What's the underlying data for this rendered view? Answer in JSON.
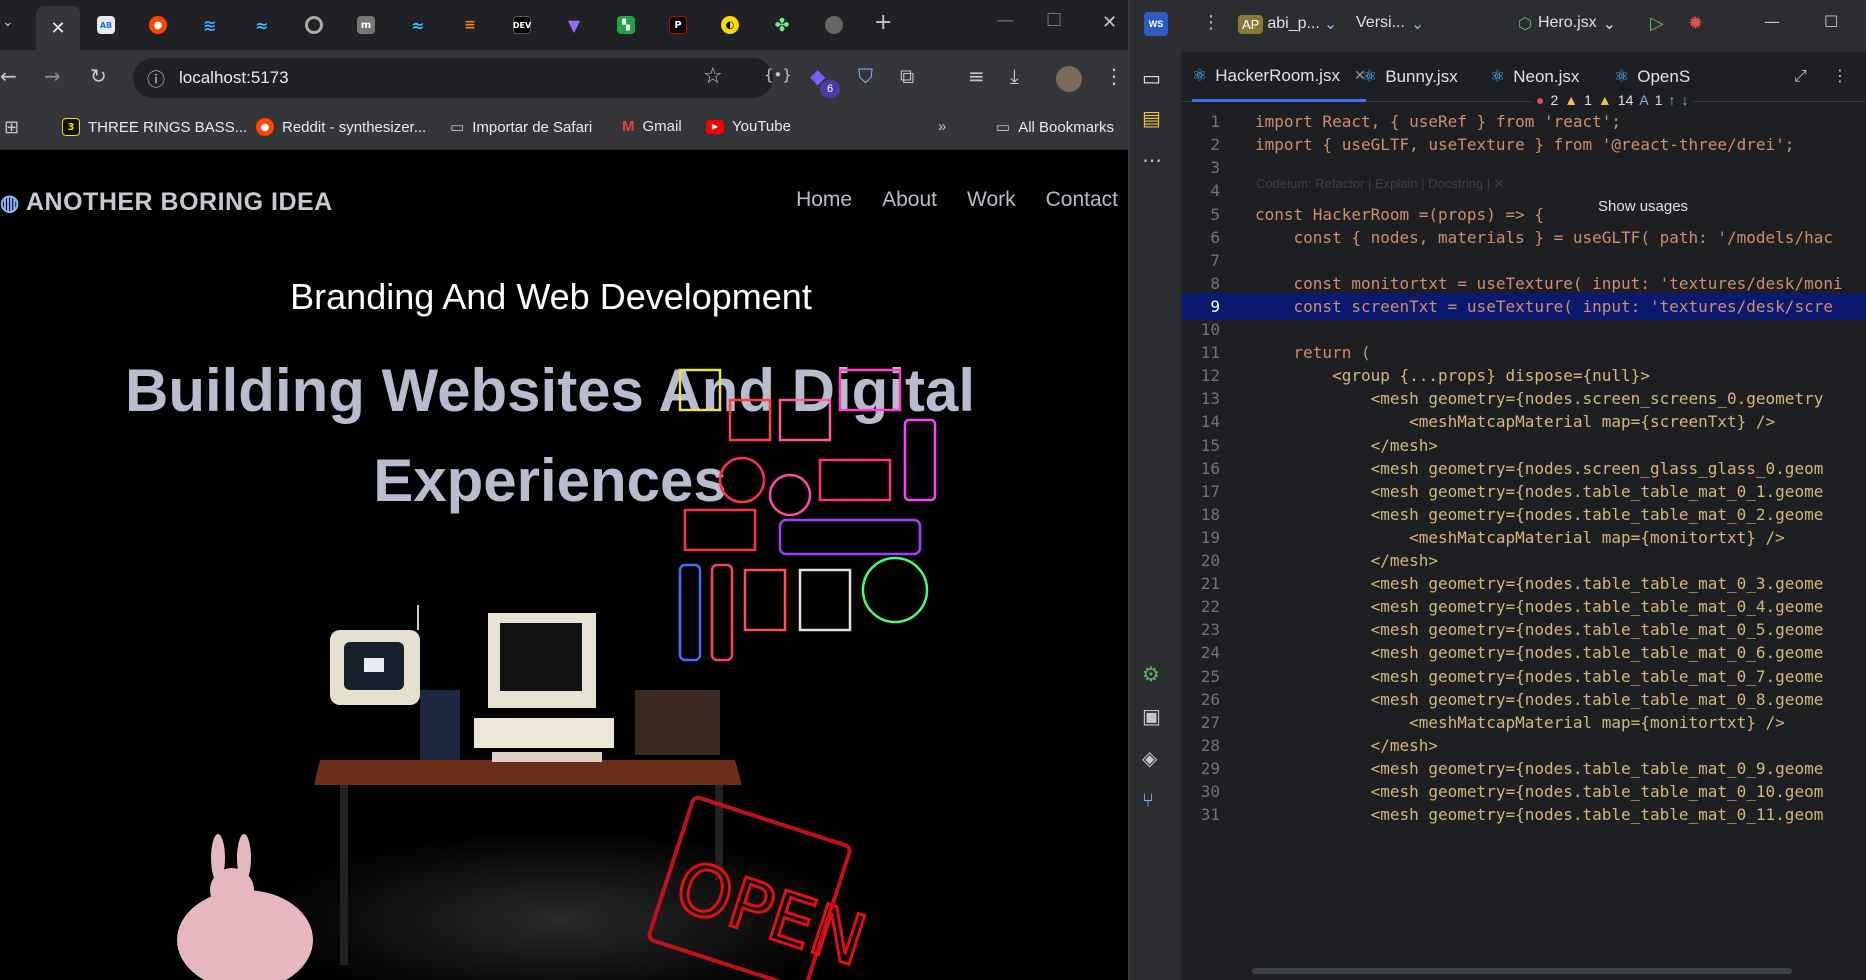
{
  "browser": {
    "url": "localhost:5173",
    "extension_badge": "6",
    "bookmarks": [
      {
        "label": "THREE RINGS BASS...",
        "icon": "three-rings-icon"
      },
      {
        "label": "Reddit - synthesizer...",
        "icon": "reddit-icon"
      },
      {
        "label": "Importar de Safari",
        "icon": "folder-icon"
      },
      {
        "label": "Gmail",
        "icon": "gmail-icon"
      },
      {
        "label": "YouTube",
        "icon": "youtube-icon"
      }
    ],
    "all_bookmarks": "All Bookmarks"
  },
  "site": {
    "logo": "ANOTHER BORING IDEA",
    "nav": [
      "Home",
      "About",
      "Work",
      "Contact"
    ],
    "subtitle": "Branding And Web Development",
    "title_line1": "Building Websites And Digital",
    "title_line2": "Experiences",
    "open_sign": "OPEN"
  },
  "ide": {
    "project": "abi_p...",
    "project_initials": "AP",
    "vcs": "Versi...",
    "run_config": "Hero.jsx",
    "tabs": [
      "HackerRoom.jsx",
      "Bunny.jsx",
      "Neon.jsx",
      "OpenS"
    ],
    "inspections": {
      "errors": "2",
      "warnings": "1",
      "weak": "14",
      "typos": "1"
    },
    "codeium_hint": "Codeium: Refactor | Explain | Docstring | ✕",
    "show_usages": "Show usages",
    "lines": [
      {
        "n": "1",
        "text": "import React, { useRef } from 'react';"
      },
      {
        "n": "2",
        "text": "import { useGLTF, useTexture } from '@react-three/drei';"
      },
      {
        "n": "3",
        "text": ""
      },
      {
        "n": "4",
        "text": ""
      },
      {
        "n": "5",
        "text": "const HackerRoom =(props) => {"
      },
      {
        "n": "6",
        "text": "    const { nodes, materials } = useGLTF( path: '/models/hac"
      },
      {
        "n": "7",
        "text": ""
      },
      {
        "n": "8",
        "text": "    const monitortxt = useTexture( input: 'textures/desk/moni"
      },
      {
        "n": "9",
        "text": "    const screenTxt = useTexture( input: 'textures/desk/scre"
      },
      {
        "n": "10",
        "text": ""
      },
      {
        "n": "11",
        "text": "    return ("
      },
      {
        "n": "12",
        "text": "        <group {...props} dispose={null}>"
      },
      {
        "n": "13",
        "text": "            <mesh geometry={nodes.screen_screens_0.geometry"
      },
      {
        "n": "14",
        "text": "                <meshMatcapMaterial map={screenTxt} />"
      },
      {
        "n": "15",
        "text": "            </mesh>"
      },
      {
        "n": "16",
        "text": "            <mesh geometry={nodes.screen_glass_glass_0.geom"
      },
      {
        "n": "17",
        "text": "            <mesh geometry={nodes.table_table_mat_0_1.geome"
      },
      {
        "n": "18",
        "text": "            <mesh geometry={nodes.table_table_mat_0_2.geome"
      },
      {
        "n": "19",
        "text": "                <meshMatcapMaterial map={monitortxt} />"
      },
      {
        "n": "20",
        "text": "            </mesh>"
      },
      {
        "n": "21",
        "text": "            <mesh geometry={nodes.table_table_mat_0_3.geome"
      },
      {
        "n": "22",
        "text": "            <mesh geometry={nodes.table_table_mat_0_4.geome"
      },
      {
        "n": "23",
        "text": "            <mesh geometry={nodes.table_table_mat_0_5.geome"
      },
      {
        "n": "24",
        "text": "            <mesh geometry={nodes.table_table_mat_0_6.geome"
      },
      {
        "n": "25",
        "text": "            <mesh geometry={nodes.table_table_mat_0_7.geome"
      },
      {
        "n": "26",
        "text": "            <mesh geometry={nodes.table_table_mat_0_8.geome"
      },
      {
        "n": "27",
        "text": "                <meshMatcapMaterial map={monitortxt} />"
      },
      {
        "n": "28",
        "text": "            </mesh>"
      },
      {
        "n": "29",
        "text": "            <mesh geometry={nodes.table_table_mat_0_9.geome"
      },
      {
        "n": "30",
        "text": "            <mesh geometry={nodes.table_table_mat_0_10.geom"
      },
      {
        "n": "31",
        "text": "            <mesh geometry={nodes.table_table_mat_0_11.geom"
      }
    ]
  },
  "colors": {
    "keyword": "#cf8e6d",
    "string": "#6aab73",
    "tag": "#d5b778",
    "current_line": "#0b1a6e",
    "accent": "#3574f0",
    "neon_red": "#e01010"
  }
}
